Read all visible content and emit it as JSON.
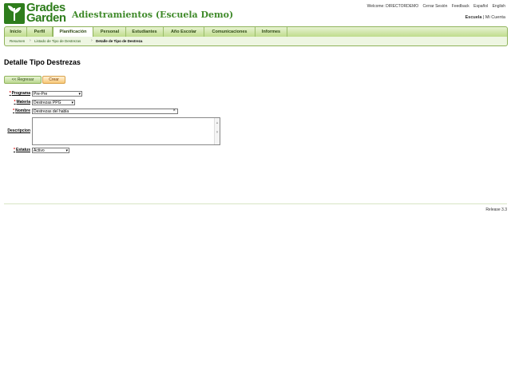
{
  "header": {
    "logo_line1": "Grades",
    "logo_line2": "Garden",
    "school_title": "Adiestramientos (Escuela Demo)",
    "welcome": "Welcome: DIRECTORDEMO",
    "links": [
      "Cerrar Sesión",
      "Feedback",
      "Español",
      "English"
    ],
    "school_label": "Escuela",
    "account_link": "Mi Cuenta"
  },
  "nav": {
    "items": [
      "Inicio",
      "Perfil",
      "Planificación",
      "Personal",
      "Estudiantes",
      "Año Escolar",
      "Comunicaciones",
      "Informes"
    ],
    "active": "Planificación"
  },
  "breadcrumb": {
    "items": [
      "Resumen",
      "Listado de Tipo de Destrezas",
      "Detalle de Tipo de Destreza"
    ]
  },
  "page": {
    "title": "Detalle Tipo Destrezas",
    "back_label": "<< Regresar",
    "create_label": "Crear"
  },
  "form": {
    "programa_label": "Programa",
    "programa_value": "Pre-Pre",
    "materia_label": "Materia",
    "materia_value": "Destrezas PPG",
    "nombre_label": "Nombre",
    "nombre_value": "Destrezas del habla",
    "descripcion_label": "Descripcion",
    "descripcion_value": "",
    "estatus_label": "Estatus",
    "estatus_value": "Activo",
    "required_mark": "*"
  },
  "footer": {
    "release": "Release 3.3"
  },
  "colors": {
    "brand_green": "#2e7d1c",
    "nav_green": "#bfdc8c",
    "create_orange": "#f8c978"
  }
}
